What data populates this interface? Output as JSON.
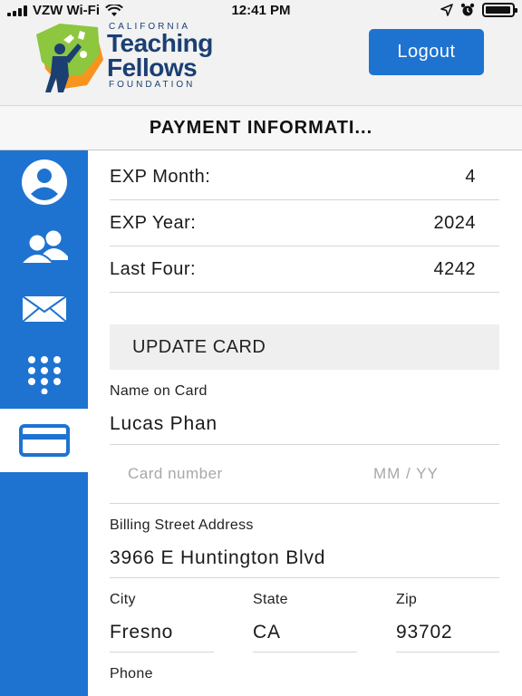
{
  "status_bar": {
    "carrier": "VZW Wi-Fi",
    "time": "12:41 PM",
    "icons": [
      "signal-bars",
      "wifi-icon",
      "location-arrow-icon",
      "alarm-icon",
      "battery-icon"
    ],
    "battery_level": 0.95
  },
  "header": {
    "logo": {
      "top_text": "CALIFORNIA",
      "line1": "Teaching",
      "line2": "Fellows",
      "bottom_text": "FOUNDATION"
    },
    "logout_label": "Logout"
  },
  "page_title": "PAYMENT INFORMATI...",
  "sidebar": {
    "items": [
      {
        "icon": "user-profile-icon",
        "active": false
      },
      {
        "icon": "users-group-icon",
        "active": false
      },
      {
        "icon": "envelope-icon",
        "active": false
      },
      {
        "icon": "keypad-icon",
        "active": false
      },
      {
        "icon": "credit-card-icon",
        "active": true
      }
    ]
  },
  "card_info": {
    "rows": [
      {
        "label": "EXP Month:",
        "value": "4"
      },
      {
        "label": "EXP Year:",
        "value": "2024"
      },
      {
        "label": "Last Four:",
        "value": "4242"
      }
    ]
  },
  "update_card": {
    "heading": "UPDATE CARD",
    "name_label": "Name on Card",
    "name_value": "Lucas Phan",
    "card_number_placeholder": "Card number",
    "exp_placeholder": "MM / YY",
    "street_label": "Billing Street Address",
    "street_value": "3966 E Huntington Blvd",
    "city_label": "City",
    "city_value": "Fresno",
    "state_label": "State",
    "state_value": "CA",
    "zip_label": "Zip",
    "zip_value": "93702",
    "phone_label": "Phone"
  },
  "colors": {
    "accent": "#1e73d1",
    "brand_navy": "#1b3f73",
    "brand_green": "#8dc63f",
    "brand_orange": "#f7941d"
  }
}
